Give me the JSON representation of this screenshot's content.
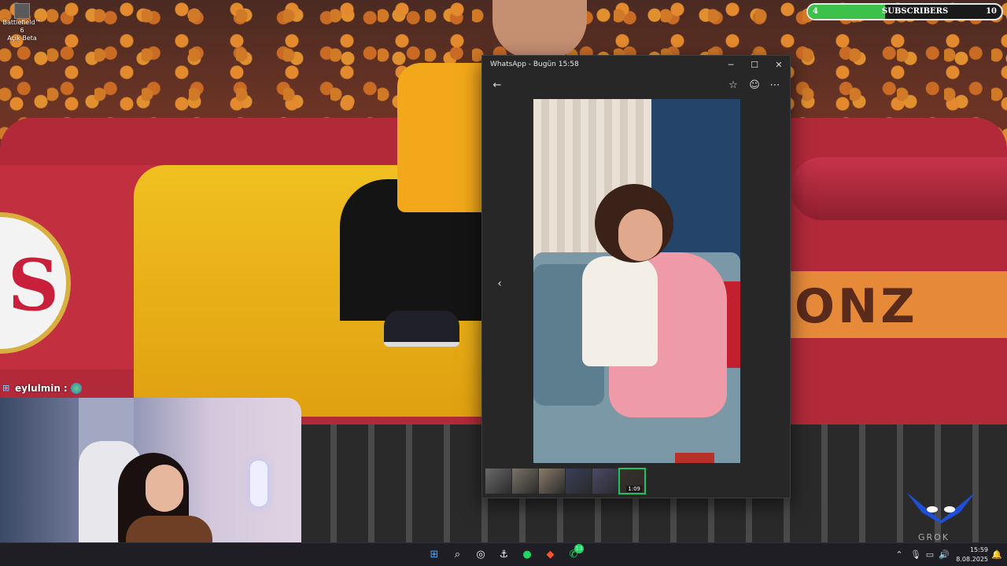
{
  "desktop": {
    "shortcut_label_line1": "Battlefield™ 6",
    "shortcut_label_line2": "Açık Beta"
  },
  "overlay": {
    "subscribers": {
      "current": "4",
      "label": "SUBSCRIBERS",
      "goal": "10",
      "progress_fraction": 0.4,
      "fill_color": "#3cc24a"
    },
    "chat": {
      "username": "eylulmin",
      "separator": ":"
    },
    "banner_text": "ONZ",
    "watermark": "GROK"
  },
  "whatsapp_window": {
    "title": "WhatsApp - Bugün 15:58",
    "controls": [
      "minimize-icon",
      "maximize-icon",
      "close-icon"
    ],
    "toolbar": [
      "back-arrow-icon",
      "star-icon",
      "emoji-icon",
      "more-icon"
    ],
    "thumbnails": [
      {
        "kind": "photo"
      },
      {
        "kind": "photo"
      },
      {
        "kind": "photo"
      },
      {
        "kind": "photo"
      },
      {
        "kind": "photo"
      },
      {
        "kind": "video",
        "duration": "1:09",
        "active": true
      }
    ],
    "accent_color": "#21c063"
  },
  "taskbar": {
    "apps": [
      {
        "name": "windows-start-icon",
        "glyph": "⊞"
      },
      {
        "name": "search-icon",
        "glyph": "⌕"
      },
      {
        "name": "steam-icon",
        "glyph": "◎"
      },
      {
        "name": "app-anchor-icon",
        "glyph": "⚓"
      },
      {
        "name": "spotify-icon",
        "glyph": "●"
      },
      {
        "name": "brave-icon",
        "glyph": "◆"
      },
      {
        "name": "whatsapp-icon",
        "glyph": "✆",
        "badge": "13"
      }
    ],
    "clock_time": "15:59",
    "clock_date": "8.08.2025"
  }
}
